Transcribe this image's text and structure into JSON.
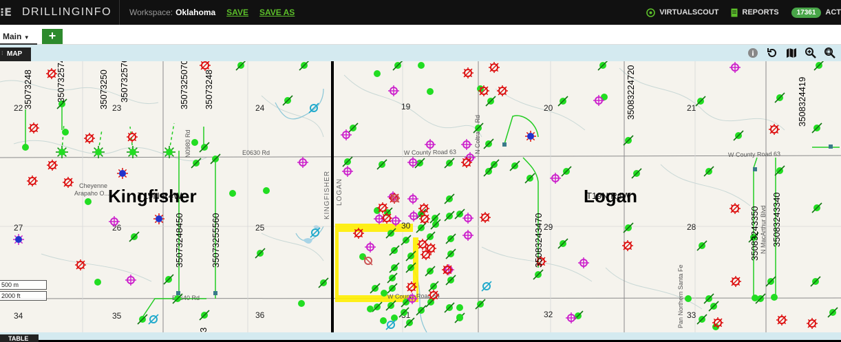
{
  "app": {
    "brand": "DRILLINGINFO",
    "workspace_label": "Workspace:",
    "workspace_name": "Oklahoma",
    "save": "SAVE",
    "save_as": "SAVE AS"
  },
  "right_nav": {
    "scout": "VIRTUALSCOUT",
    "reports": "REPORTS",
    "badge": "17361",
    "act": "ACT"
  },
  "tabs": {
    "main": "Main",
    "add": "+"
  },
  "panel": {
    "title": "MAP",
    "table_title": "TABLE"
  },
  "scale": {
    "meters": "500 m",
    "feet": "2000 ft"
  },
  "colors": {
    "active_well": "#22dd22",
    "permit": "#cc22cc",
    "plugged": "#dd1111",
    "highlight": "#ffee00"
  },
  "map": {
    "counties": [
      "Kingfisher",
      "Logan"
    ],
    "township_label": "T19N R4W",
    "boundary_labels": [
      "KINGFISHER",
      "LOGAN"
    ],
    "place": [
      "Cheyenne",
      "Arapaho O..."
    ],
    "roads": [
      "E0630 Rd",
      "W County Road 63",
      "W County Road 63",
      "W County Road 64",
      "E0640 Rd",
      "N0980 Rd",
      "N Coltrane Rd",
      "N MacArthur Blvd",
      "Pan Northern Santa Fe"
    ],
    "sections": [
      "22",
      "23",
      "24",
      "19",
      "20",
      "21",
      "27",
      "26",
      "25",
      "30",
      "29",
      "28",
      "34",
      "35",
      "36",
      "31",
      "32",
      "33"
    ],
    "api_labels": [
      "35073248",
      "35073250",
      "3507325740",
      "3507325760",
      "3507325070",
      "35073248",
      "35083224720",
      "3508324419",
      "35083243470",
      "35073248450",
      "35073255560",
      "35083243350",
      "35083243340",
      "3"
    ],
    "partial_labels": [
      "3507",
      "3"
    ]
  }
}
